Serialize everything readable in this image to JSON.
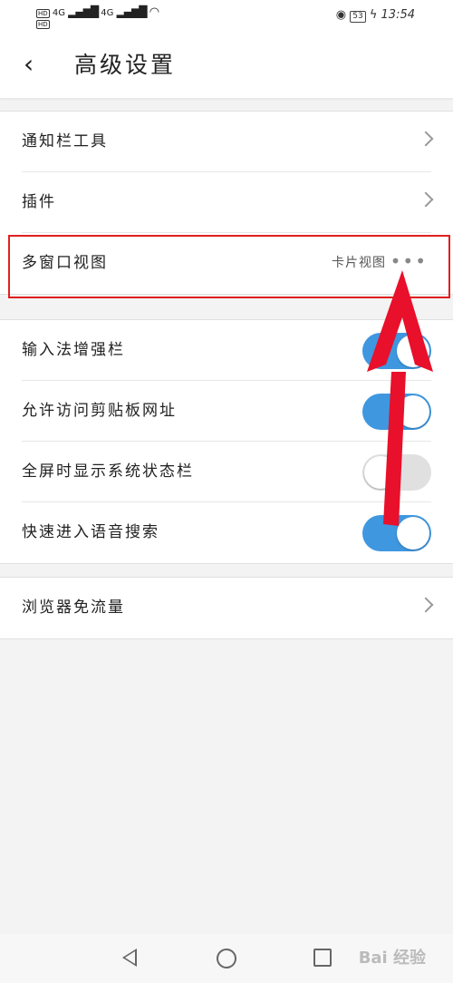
{
  "status_bar": {
    "hd1": "HD",
    "hd2": "HD",
    "net1": "4G",
    "net2": "4G",
    "battery": "53",
    "time": "13:54"
  },
  "header": {
    "back_glyph": "‹",
    "title": "高级设置"
  },
  "group1": {
    "items": [
      {
        "label": "通知栏工具"
      },
      {
        "label": "插件"
      },
      {
        "label": "多窗口视图",
        "value": "卡片视图"
      }
    ]
  },
  "group2": {
    "items": [
      {
        "label": "输入法增强栏",
        "enabled": true
      },
      {
        "label": "允许访问剪贴板网址",
        "enabled": true
      },
      {
        "label": "全屏时显示系统状态栏",
        "enabled": false
      },
      {
        "label": "快速进入语音搜索",
        "enabled": true
      }
    ]
  },
  "group3": {
    "items": [
      {
        "label": "浏览器免流量"
      }
    ]
  },
  "watermark": "Bai 经验",
  "colors": {
    "toggle_on": "#3f97e0",
    "highlight": "#e02020",
    "arrow": "#e8102a"
  },
  "icons": [
    "eye-icon",
    "wifi-icon",
    "signal-icon",
    "chevron-right-icon",
    "more-icon",
    "nav-back-icon",
    "nav-home-icon",
    "nav-recent-icon"
  ]
}
